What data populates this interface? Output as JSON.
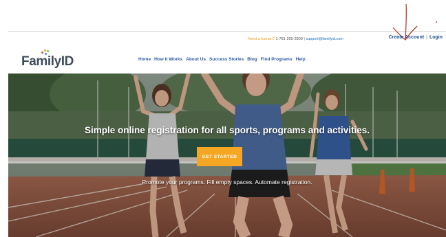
{
  "header": {
    "help_prefix": "Need a human?",
    "phone": "1-781-205-2800",
    "separator": "|",
    "email": "support@familyid.com",
    "create_account": "Create Account",
    "account_separator": "|",
    "login": "Login"
  },
  "logo": {
    "text": "FamilyID"
  },
  "nav": [
    {
      "label": "Home"
    },
    {
      "label": "How it Works"
    },
    {
      "label": "About Us"
    },
    {
      "label": "Success Stories"
    },
    {
      "label": "Blog"
    },
    {
      "label": "Find Programs"
    },
    {
      "label": "Help"
    }
  ],
  "hero": {
    "headline": "Simple online registration for all sports, programs and activities.",
    "cta_label": "GET STARTED",
    "tagline": "Promote your programs. Fill empty spaces. Automate registration."
  },
  "colors": {
    "brand_text": "#3e4d5c",
    "nav_link": "#2c5aa0",
    "account_link": "#1e4e8c",
    "cta": "#f5a623",
    "help_accent": "#f2a01d",
    "annotation": "#c0392b"
  },
  "icons": {
    "logo_mark": "colored-dots-icon",
    "annotation": "red-arrow-icon"
  }
}
